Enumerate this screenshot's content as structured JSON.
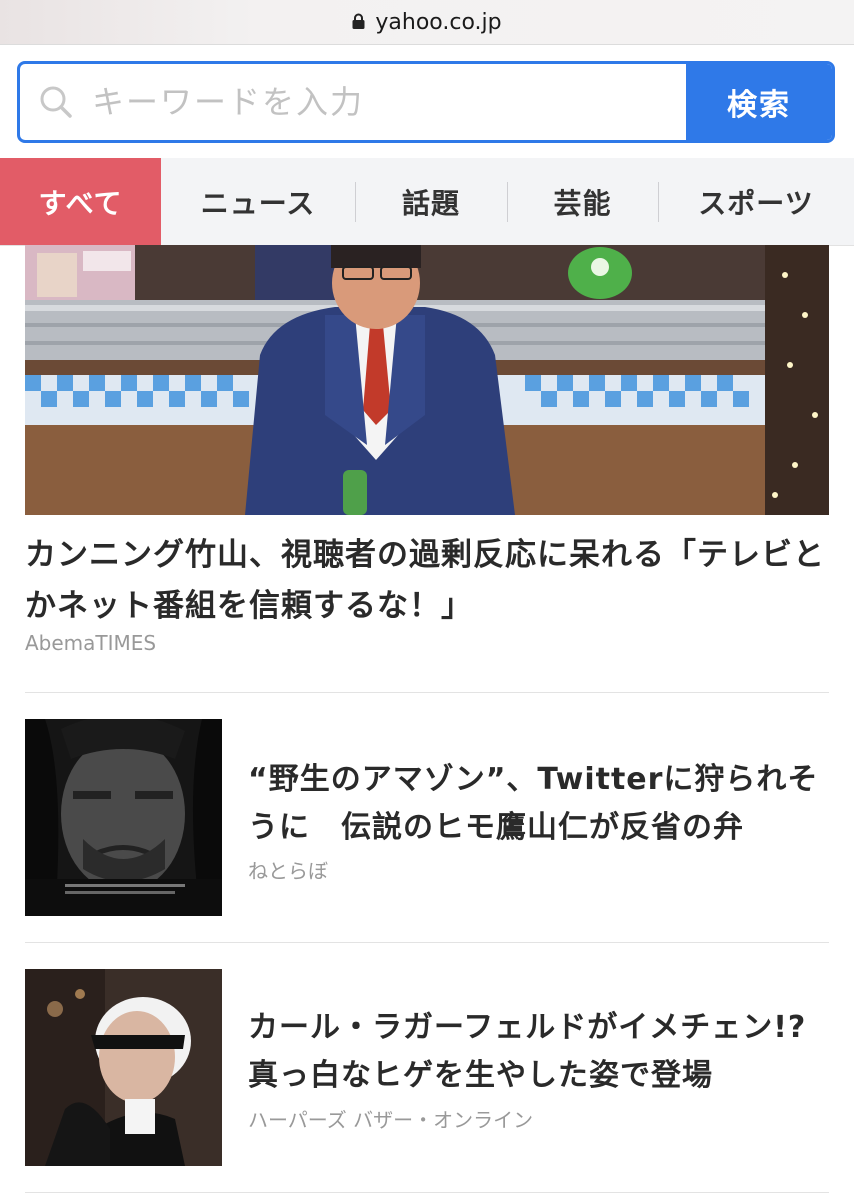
{
  "browser": {
    "url": "yahoo.co.jp"
  },
  "search": {
    "placeholder": "キーワードを入力",
    "button_label": "検索"
  },
  "tabs": [
    {
      "label": "すべて",
      "active": true
    },
    {
      "label": "ニュース",
      "active": false
    },
    {
      "label": "話題",
      "active": false
    },
    {
      "label": "芸能",
      "active": false
    },
    {
      "label": "スポーツ",
      "active": false
    }
  ],
  "hero": {
    "title": "カンニング竹山、視聴者の過剰反応に呆れる「テレビとかネット番組を信頼するな！」",
    "source": "AbemaTIMES",
    "image": "tv-studio-photo"
  },
  "articles": [
    {
      "title": "“野生のアマゾン”、Twitterに狩られそうに　伝説のヒモ鷹山仁が反省の弁",
      "source": "ねとらぼ",
      "image": "dark-portrait-photo"
    },
    {
      "title": "カール・ラガーフェルドがイメチェン!? 真っ白なヒゲを生やした姿で登場",
      "source": "ハーパーズ バザー・オンライン",
      "image": "white-hair-sunglasses-photo"
    }
  ],
  "colors": {
    "accent_blue": "#2f79e8",
    "active_tab": "#e25c67"
  }
}
